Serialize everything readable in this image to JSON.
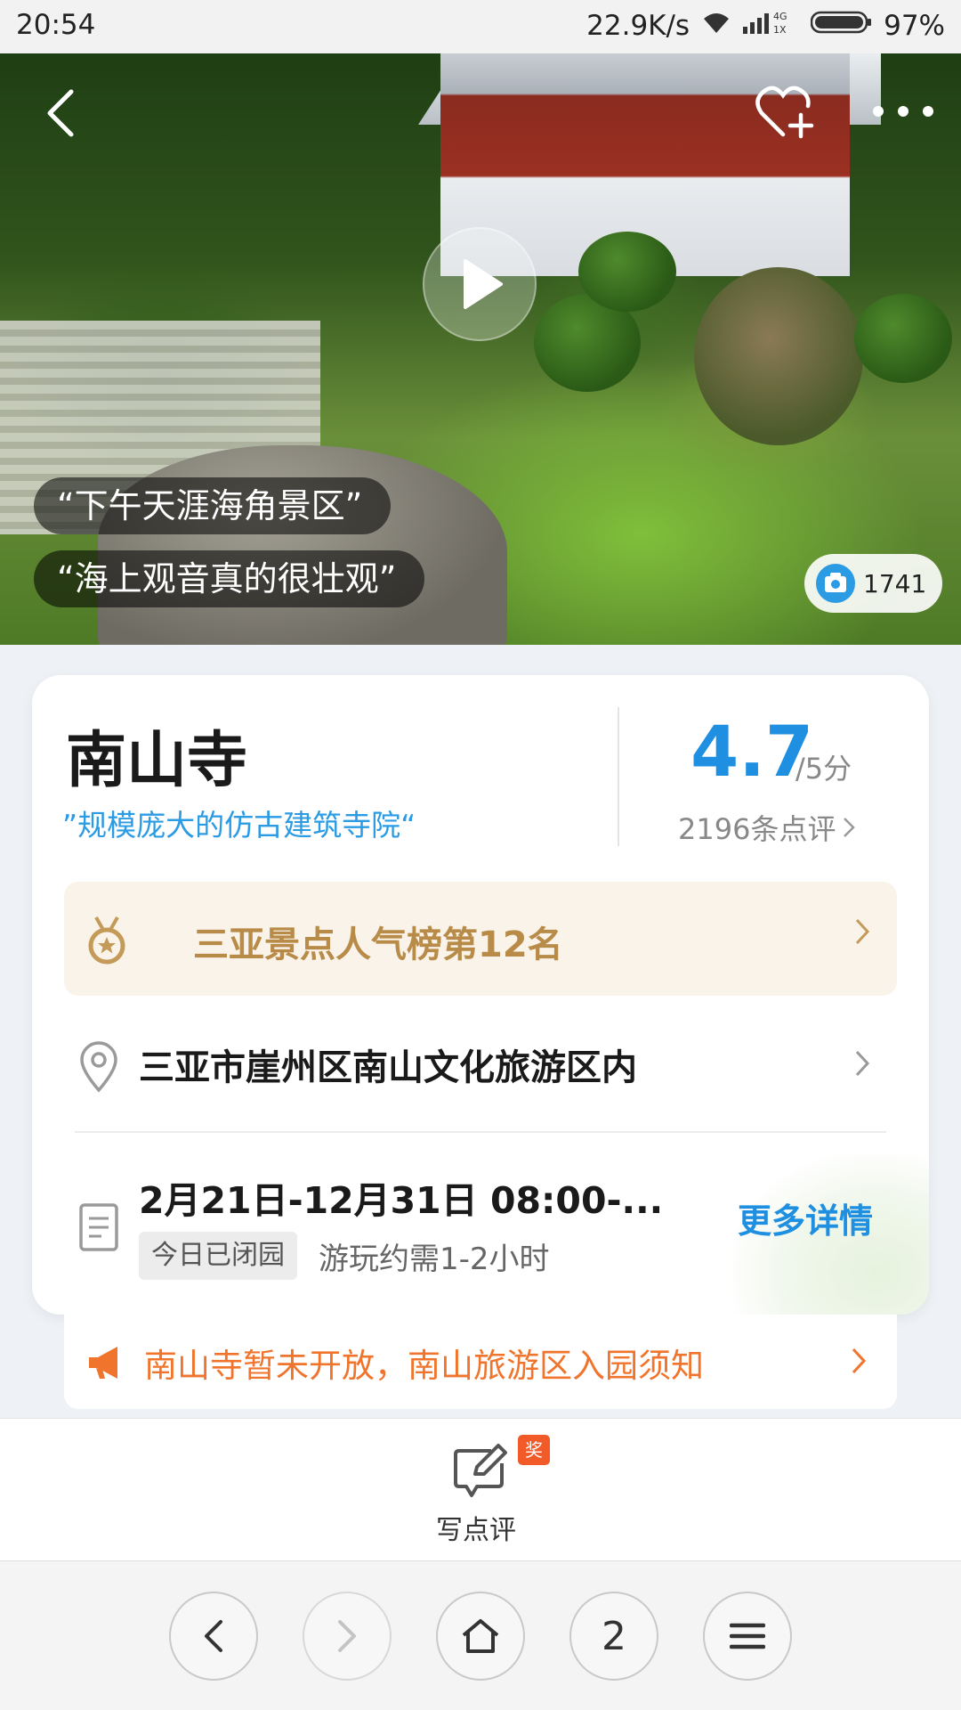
{
  "status_bar": {
    "time": "20:54",
    "network_speed": "22.9K/s",
    "net_type_top": "4G",
    "net_type_bottom": "1X",
    "battery": "97%"
  },
  "hero": {
    "quotes": [
      "“下午天涯海角景区”",
      "“海上观音真的很壮观”"
    ],
    "photo_count": "1741",
    "icons": [
      "back-icon",
      "favorite-add-icon",
      "more-icon",
      "play-icon",
      "camera-icon"
    ]
  },
  "attraction": {
    "name": "南山寺",
    "tagline": "”规模庞大的仿古建筑寺院“",
    "score": "4.7",
    "score_unit": "/5分",
    "review_count": "2196条点评"
  },
  "ranking": {
    "label": "三亚景点人气榜第12名"
  },
  "address": {
    "text": "三亚市崖州区南山文化旅游区内"
  },
  "hours": {
    "schedule": "2月21日-12月31日 08:00-...",
    "status_badge": "今日已闭园",
    "duration": "游玩约需1-2小时",
    "more_link": "更多详情"
  },
  "notice": {
    "text": "南山寺暂未开放，南山旅游区入园须知"
  },
  "review_bar": {
    "badge": "奖",
    "label": "写点评"
  },
  "browser_nav": {
    "tabs_count": "2"
  },
  "colors": {
    "accent_blue": "#1e8fe1",
    "rank_gold": "#b98b48",
    "notice_orange": "#f0742c",
    "award_red": "#f25a2a"
  }
}
